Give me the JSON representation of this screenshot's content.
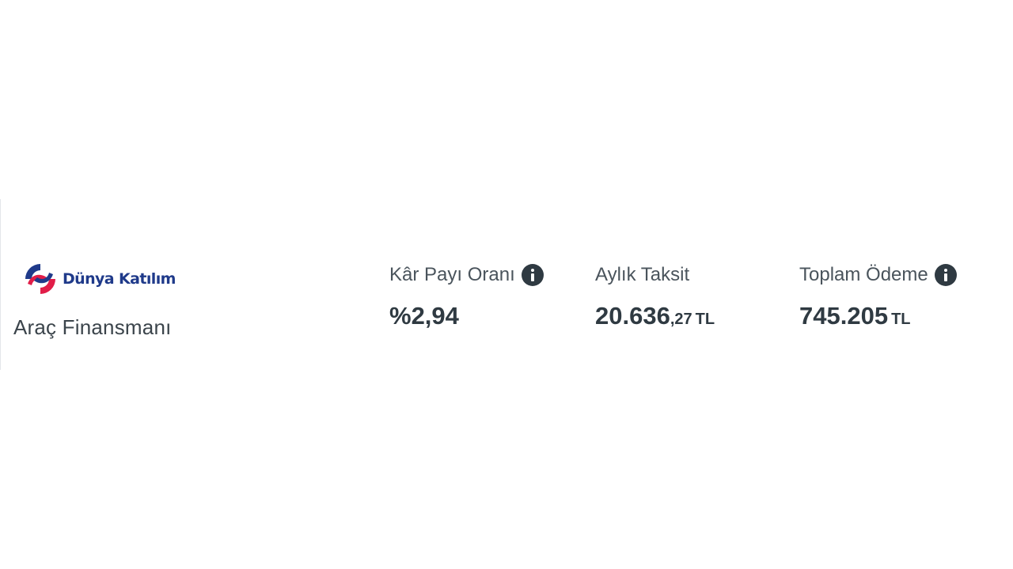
{
  "bank": {
    "name": "Dünya Katılım",
    "product": "Araç Finansmanı",
    "brand_colors": [
      "#1f3a8a",
      "#e11d48"
    ]
  },
  "metrics": {
    "profit_rate": {
      "label": "Kâr Payı Oranı",
      "value": "%2,94",
      "icon": "info-icon"
    },
    "monthly_installment": {
      "label": "Aylık Taksit",
      "value_main": "20.636",
      "value_decimal": ",27",
      "currency": "TL"
    },
    "total_payment": {
      "label": "Toplam Ödeme",
      "value": "745.205",
      "currency": "TL",
      "icon": "info-icon"
    }
  }
}
